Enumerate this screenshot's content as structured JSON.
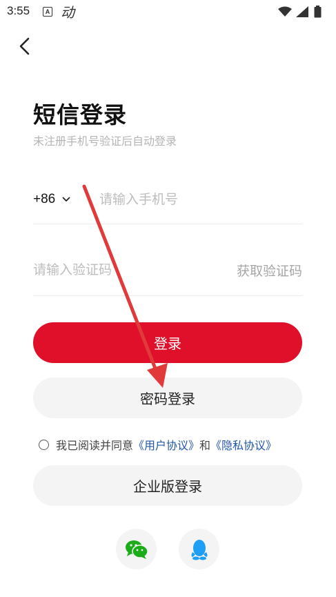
{
  "status_bar": {
    "time": "3:55",
    "notification_a": "A",
    "notification_dong": "动"
  },
  "header": {
    "title": "短信登录",
    "subtitle": "未注册手机号验证后自动登录"
  },
  "phone": {
    "country_code": "+86",
    "placeholder": "请输入手机号",
    "value": ""
  },
  "code": {
    "placeholder": "请输入验证码",
    "value": "",
    "get_code_label": "获取验证码"
  },
  "buttons": {
    "login_label": "登录",
    "password_login_label": "密码登录",
    "enterprise_login_label": "企业版登录"
  },
  "agreement": {
    "prefix": "我已阅读并同意",
    "user_agreement": "《用户协议》",
    "and": "和",
    "privacy_agreement": "《隐私协议》",
    "checked": false
  },
  "social": {
    "wechat_icon": "wechat-icon",
    "qq_icon": "qq-icon"
  },
  "colors": {
    "primary": "#e0102a",
    "link": "#2356a8",
    "placeholder": "#bdbdbd",
    "secondary_button_bg": "#f4f4f4",
    "annotation_arrow": "#e03a3a",
    "wechat": "#1aad19",
    "qq": "#1e9ef5"
  }
}
